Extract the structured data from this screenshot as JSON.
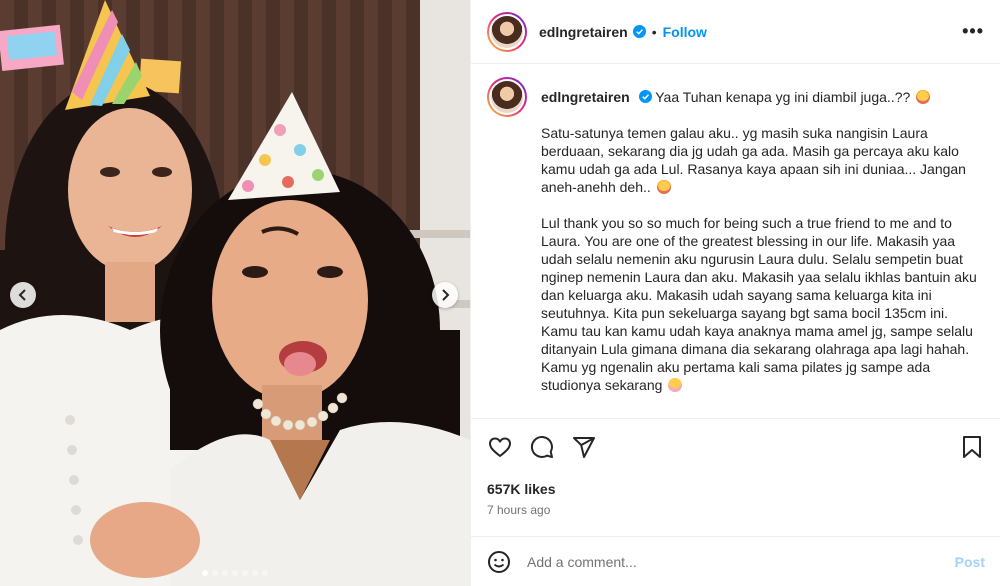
{
  "header": {
    "username": "edlngretairen",
    "separator": "•",
    "follow_label": "Follow",
    "more_label": "•••"
  },
  "caption": {
    "username": "edlngretairen",
    "title_text": "Yaa Tuhan kenapa yg ini diambil juga..??",
    "paragraph1": "Satu-satunya temen galau aku.. yg masih suka nangisin Laura berduaan, sekarang dia jg udah ga ada. Masih ga percaya aku kalo kamu udah ga ada Lul. Rasanya kaya apaan sih ini duniaa... Jangan aneh-anehh deh..",
    "paragraph2": "Lul thank you so so much for being such a true friend to me and to Laura. You are one of the greatest blessing in our life. Makasih yaa udah selalu nemenin aku ngurusin Laura dulu. Selalu sempetin buat nginep nemenin Laura dan aku. Makasih yaa selalu ikhlas bantuin aku dan keluarga aku. Makasih udah sayang sama keluarga kita ini seutuhnya. Kita pun sekeluarga sayang bgt sama bocil 135cm ini. Kamu tau kan kamu udah kaya anaknya mama amel jg, sampe selalu ditanyain Lula gimana dimana dia sekarang olahraga apa lagi hahah. Kamu yg ngenalin aku pertama kali sama pilates jg sampe ada studionya sekarang"
  },
  "stats": {
    "likes": "657K likes",
    "time": "7 hours ago"
  },
  "comment": {
    "placeholder": "Add a comment...",
    "post_label": "Post"
  },
  "carousel": {
    "slide_count": 7,
    "active_index": 0
  },
  "colors": {
    "accent": "#0095f6",
    "post_disabled": "#a3d2f7",
    "verified": "#0095f6"
  },
  "icons": [
    "chevron-left-icon",
    "chevron-right-icon",
    "verified-badge-icon",
    "more-icon",
    "heart-icon",
    "comment-icon",
    "share-icon",
    "bookmark-icon",
    "emoji-icon"
  ]
}
